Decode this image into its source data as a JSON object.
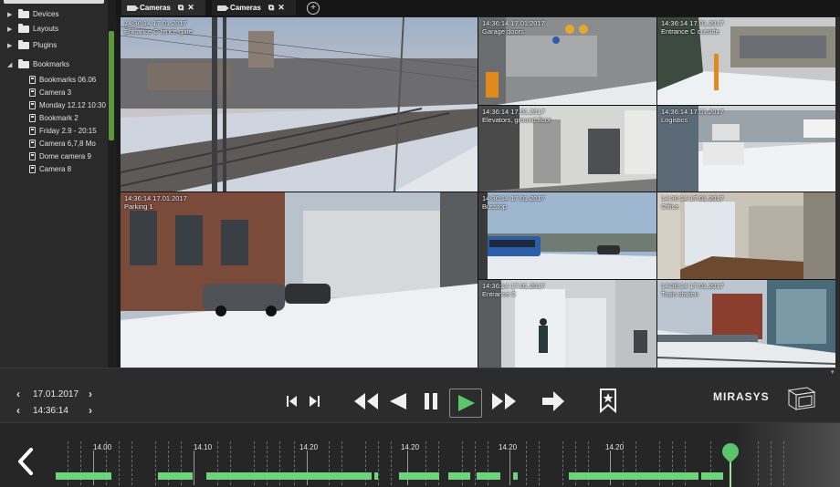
{
  "sidebar": {
    "items": [
      {
        "label": "Devices",
        "type": "folder"
      },
      {
        "label": "Layouts",
        "type": "folder"
      },
      {
        "label": "Plugins",
        "type": "folder"
      },
      {
        "label": "Bookmarks",
        "type": "folder-open"
      }
    ],
    "bookmarks": [
      "Bookmarks 06.06",
      "Camera 3",
      "Monday 12.12 10:30",
      "Bookmark 2",
      "Friday 2.9 - 20:15",
      "Camera 6,7,8 Mo",
      "Dome camera 9",
      "Camera 8"
    ]
  },
  "tabs": [
    {
      "label": "Cameras"
    },
    {
      "label": "Cameras"
    }
  ],
  "cameras": [
    {
      "time": "14:36:14  17.01.2017",
      "name": "Entrance C fence gate"
    },
    {
      "time": "14:36:14  17.01.2017",
      "name": "Garage doors"
    },
    {
      "time": "14:36:14  17.01.2017",
      "name": "Entrance C outside"
    },
    {
      "time": "14:36:14  17.01.2017",
      "name": "Elevators, ground floor"
    },
    {
      "time": "14:36:14  17.01.2017",
      "name": "Logistics"
    },
    {
      "time": "14:36:14  17.01.2017",
      "name": "Parking 1"
    },
    {
      "time": "14:36:14  17.01.2017",
      "name": "Busstop"
    },
    {
      "time": "14:36:14  17.01.2017",
      "name": "Office"
    },
    {
      "time": "14:36:14  17.01.2017",
      "name": "Entrance C"
    },
    {
      "time": "14:36:14  17.01.2017",
      "name": "Train station"
    }
  ],
  "controls": {
    "date": "17.01.2017",
    "time": "14:36:14",
    "logo": "MIRASYS"
  },
  "timeline": {
    "labels": [
      "14.00",
      "14.10",
      "14.20",
      "14.20",
      "14.20",
      "14.20"
    ]
  },
  "colors": {
    "accent": "#5ac56a",
    "recording": "#6ed47c",
    "background": "#1b1b1b"
  }
}
